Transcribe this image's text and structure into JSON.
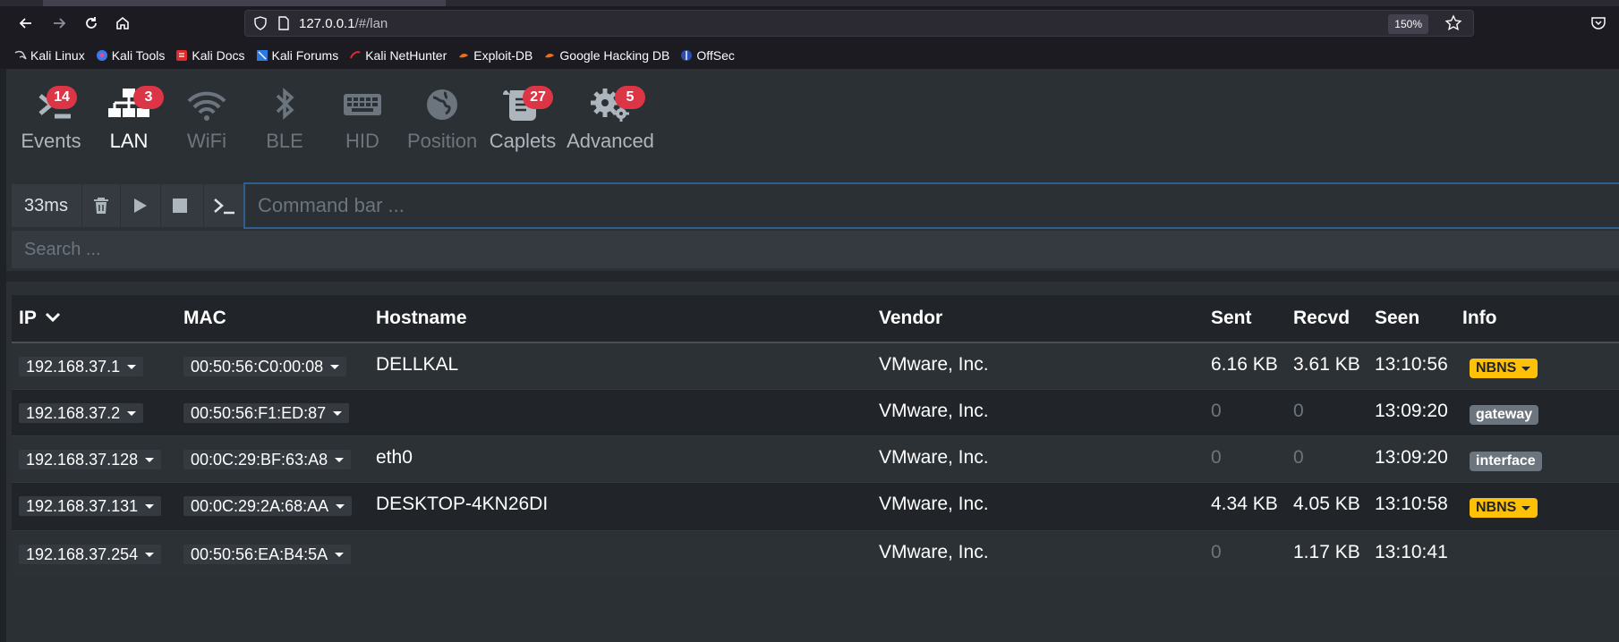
{
  "browser": {
    "url_host": "127.0.0.1",
    "url_path": "/#/lan",
    "zoom": "150%",
    "bookmarks": [
      {
        "label": "Kali Linux",
        "icon": "kali-dragon-icon"
      },
      {
        "label": "Kali Tools",
        "icon": "kali-tools-icon"
      },
      {
        "label": "Kali Docs",
        "icon": "kali-docs-icon"
      },
      {
        "label": "Kali Forums",
        "icon": "kali-forums-icon"
      },
      {
        "label": "Kali NetHunter",
        "icon": "nethunter-icon"
      },
      {
        "label": "Exploit-DB",
        "icon": "exploit-db-icon"
      },
      {
        "label": "Google Hacking DB",
        "icon": "ghdb-icon"
      },
      {
        "label": "OffSec",
        "icon": "offsec-icon"
      }
    ]
  },
  "nav": {
    "tabs": [
      {
        "label": "Events",
        "badge": "14",
        "icon": "terminal-icon"
      },
      {
        "label": "LAN",
        "badge": "3",
        "icon": "network-icon"
      },
      {
        "label": "WiFi",
        "badge": "",
        "icon": "wifi-icon"
      },
      {
        "label": "BLE",
        "badge": "",
        "icon": "bluetooth-icon"
      },
      {
        "label": "HID",
        "badge": "",
        "icon": "keyboard-icon"
      },
      {
        "label": "Position",
        "badge": "",
        "icon": "globe-icon"
      },
      {
        "label": "Caplets",
        "badge": "27",
        "icon": "scroll-icon"
      },
      {
        "label": "Advanced",
        "badge": "5",
        "icon": "gears-icon"
      }
    ]
  },
  "command": {
    "latency": "33ms",
    "placeholder": "Command bar ...",
    "search_placeholder": "Search ..."
  },
  "table": {
    "headers": {
      "ip": "IP",
      "mac": "MAC",
      "hostname": "Hostname",
      "vendor": "Vendor",
      "sent": "Sent",
      "recvd": "Recvd",
      "seen": "Seen",
      "info": "Info"
    },
    "rows": [
      {
        "ip": "192.168.37.1",
        "mac": "00:50:56:C0:00:08",
        "hostname": "DELLKAL",
        "vendor": "VMware, Inc.",
        "sent": "6.16 KB",
        "recvd": "3.61 KB",
        "seen": "13:10:56",
        "info": "NBNS"
      },
      {
        "ip": "192.168.37.2",
        "mac": "00:50:56:F1:ED:87",
        "hostname": "",
        "vendor": "VMware, Inc.",
        "sent": "0",
        "recvd": "0",
        "seen": "13:09:20",
        "info": "gateway"
      },
      {
        "ip": "192.168.37.128",
        "mac": "00:0C:29:BF:63:A8",
        "hostname": "eth0",
        "vendor": "VMware, Inc.",
        "sent": "0",
        "recvd": "0",
        "seen": "13:09:20",
        "info": "interface"
      },
      {
        "ip": "192.168.37.131",
        "mac": "00:0C:29:2A:68:AA",
        "hostname": "DESKTOP-4KN26DI",
        "vendor": "VMware, Inc.",
        "sent": "4.34 KB",
        "recvd": "4.05 KB",
        "seen": "13:10:58",
        "info": "NBNS"
      },
      {
        "ip": "192.168.37.254",
        "mac": "00:50:56:EA:B4:5A",
        "hostname": "",
        "vendor": "VMware, Inc.",
        "sent": "0",
        "recvd": "1.17 KB",
        "seen": "13:10:41",
        "info": ""
      }
    ]
  },
  "colors": {
    "badge": "#dc3545",
    "nbns": "#ffc107",
    "grey_tag": "#6c757d",
    "focus_border": "#2f5f8c"
  }
}
